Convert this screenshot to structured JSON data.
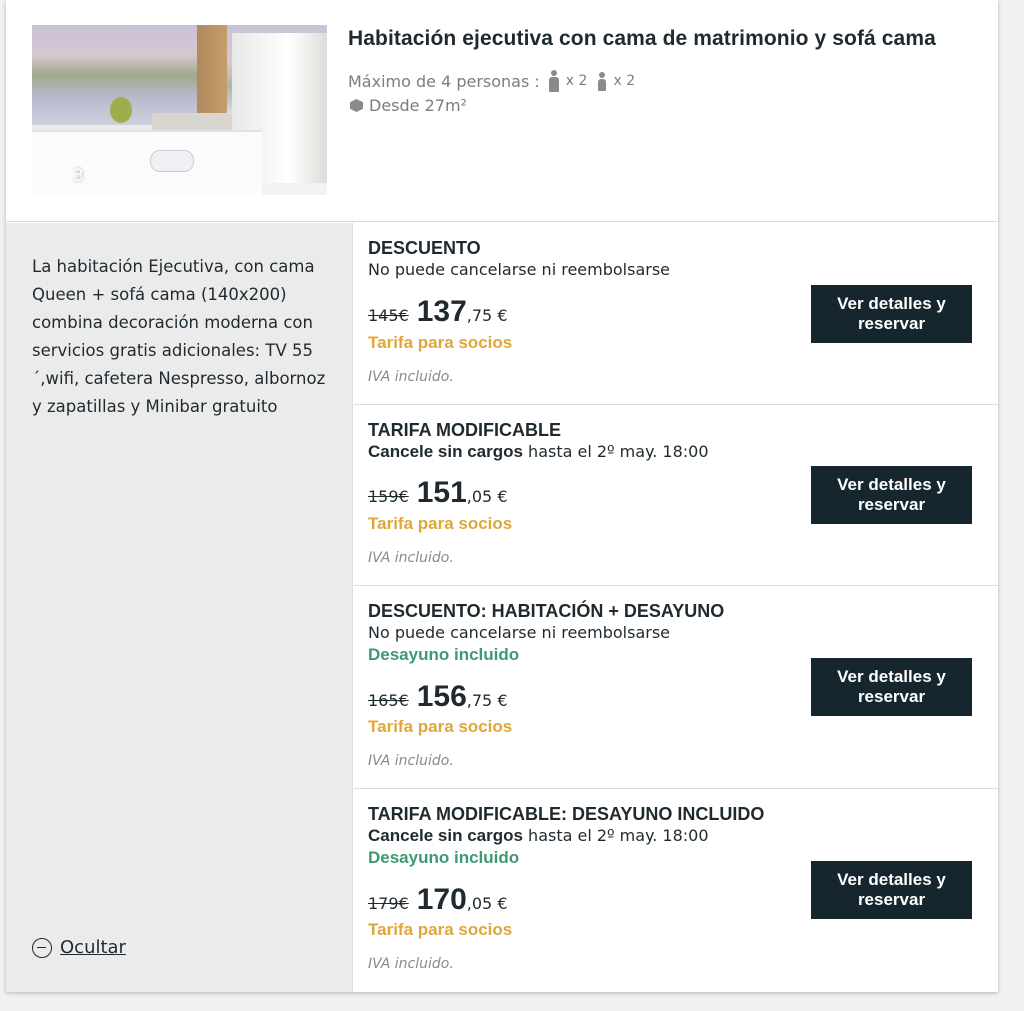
{
  "room": {
    "title": "Habitación ejecutiva con cama de matrimonio y sofá cama",
    "photo_count": "3",
    "capacity_label": "Máximo de 4 personas :",
    "adults_mult": "x 2",
    "children_mult": "x 2",
    "size_label": "Desde 27m²",
    "description": "La habitación Ejecutiva, con cama Queen + sofá cama (140x200) combina decoración moderna con servicios gratis adicionales: TV 55´,wifi, cafetera Nespresso, albornoz y zapatillas y Minibar gratuito",
    "hide_label": "Ocultar"
  },
  "rates": [
    {
      "name": "DESCUENTO",
      "condition_bold": "",
      "condition": "No puede cancelarse ni reembolsarse",
      "breakfast": "",
      "old_price": "145€",
      "price_int": "137",
      "price_dec": ",75 €",
      "member": "Tarifa para socios",
      "vat": "IVA incluido.",
      "button": "Ver detalles y reservar"
    },
    {
      "name": "TARIFA MODIFICABLE",
      "condition_bold": "Cancele sin cargos",
      "condition": " hasta el 2º may. 18:00",
      "breakfast": "",
      "old_price": "159€",
      "price_int": "151",
      "price_dec": ",05 €",
      "member": "Tarifa para socios",
      "vat": "IVA incluido.",
      "button": "Ver detalles y reservar"
    },
    {
      "name": "DESCUENTO: HABITACIÓN + DESAYUNO",
      "condition_bold": "",
      "condition": "No puede cancelarse ni reembolsarse",
      "breakfast": "Desayuno incluido",
      "old_price": "165€",
      "price_int": "156",
      "price_dec": ",75 €",
      "member": "Tarifa para socios",
      "vat": "IVA incluido.",
      "button": "Ver detalles y reservar"
    },
    {
      "name": "TARIFA MODIFICABLE: DESAYUNO INCLUIDO",
      "condition_bold": "Cancele sin cargos",
      "condition": " hasta el 2º may. 18:00",
      "breakfast": "Desayuno incluido",
      "old_price": "179€",
      "price_int": "170",
      "price_dec": ",05 €",
      "member": "Tarifa para socios",
      "vat": "IVA incluido.",
      "button": "Ver detalles y reservar"
    }
  ],
  "colors": {
    "button_bg": "#16262f",
    "member_rate": "#e0a63a",
    "breakfast": "#3d9a72"
  }
}
